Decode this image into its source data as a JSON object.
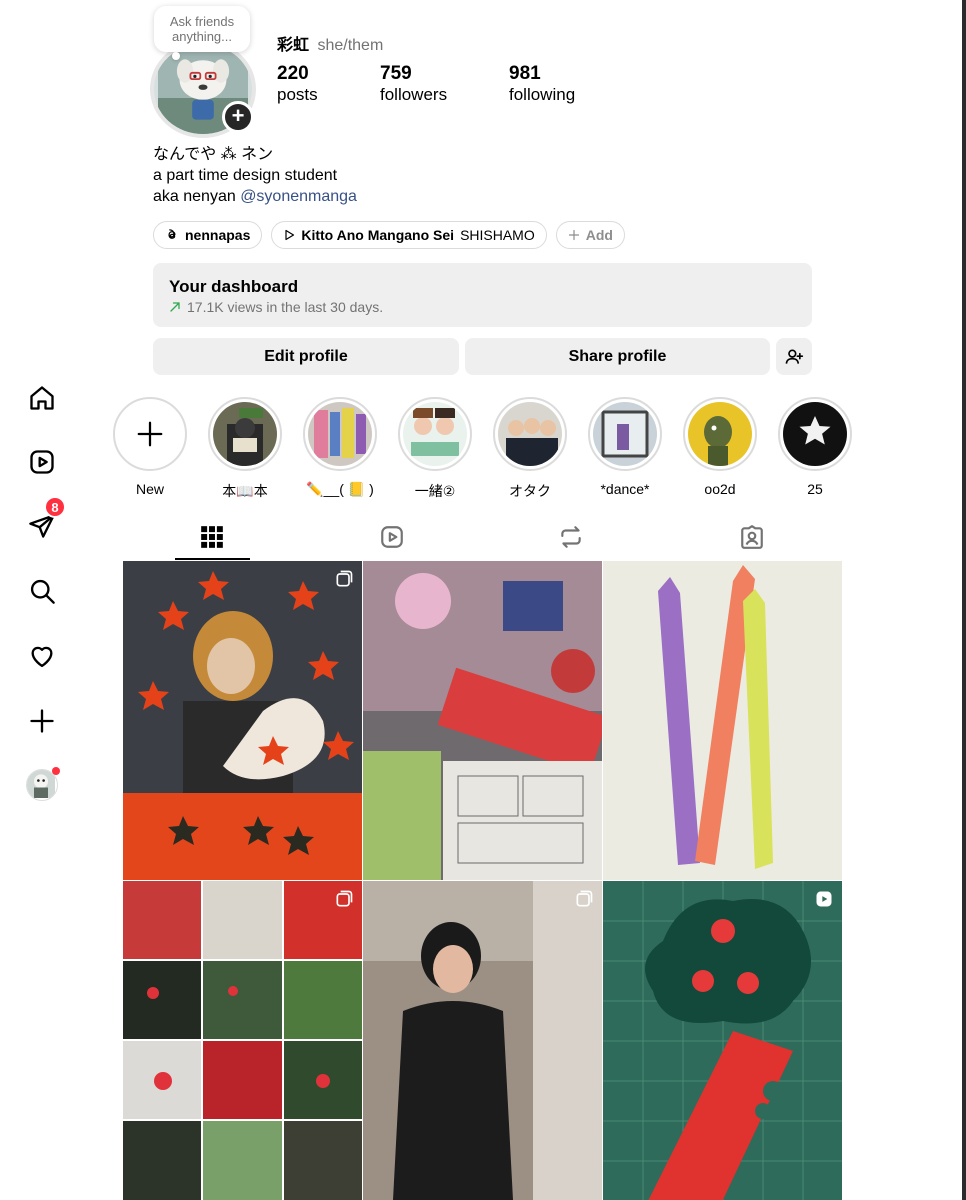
{
  "nav": {
    "messages_badge": "8"
  },
  "profile": {
    "note": "Ask friends anything...",
    "username": "彩虹",
    "pronouns": "she/them",
    "stats": {
      "posts": {
        "num": "220",
        "label": "posts"
      },
      "followers": {
        "num": "759",
        "label": "followers"
      },
      "following": {
        "num": "981",
        "label": "following"
      }
    },
    "bio": {
      "line1": "なんでや ⁂ ネン",
      "line2": "a part time design student",
      "line3_prefix": "aka nenyan ",
      "line3_mention": "@syonenmanga"
    },
    "chips": {
      "threads": "nennapas",
      "song_title": "Kitto Ano Mangano Sei",
      "song_artist": "SHISHAMO",
      "add": "Add"
    },
    "dashboard": {
      "title": "Your dashboard",
      "subtitle": "17.1K views in the last 30 days."
    },
    "buttons": {
      "edit": "Edit profile",
      "share": "Share profile"
    }
  },
  "highlights": [
    {
      "label": "New"
    },
    {
      "label": "本📖本"
    },
    {
      "label": "✏️__( 📒 )"
    },
    {
      "label": "一緒②"
    },
    {
      "label": "オタク"
    },
    {
      "label": "*dance*"
    },
    {
      "label": "oo2d"
    },
    {
      "label": "25"
    }
  ],
  "tabs": [
    "posts-grid",
    "reels",
    "reposts",
    "tagged"
  ],
  "colors": {
    "accent_red": "#ff3040",
    "mention_blue": "#385185",
    "trend_green": "#2fa84f",
    "chip_border": "#dbdbdb",
    "button_bg": "#efefef"
  }
}
